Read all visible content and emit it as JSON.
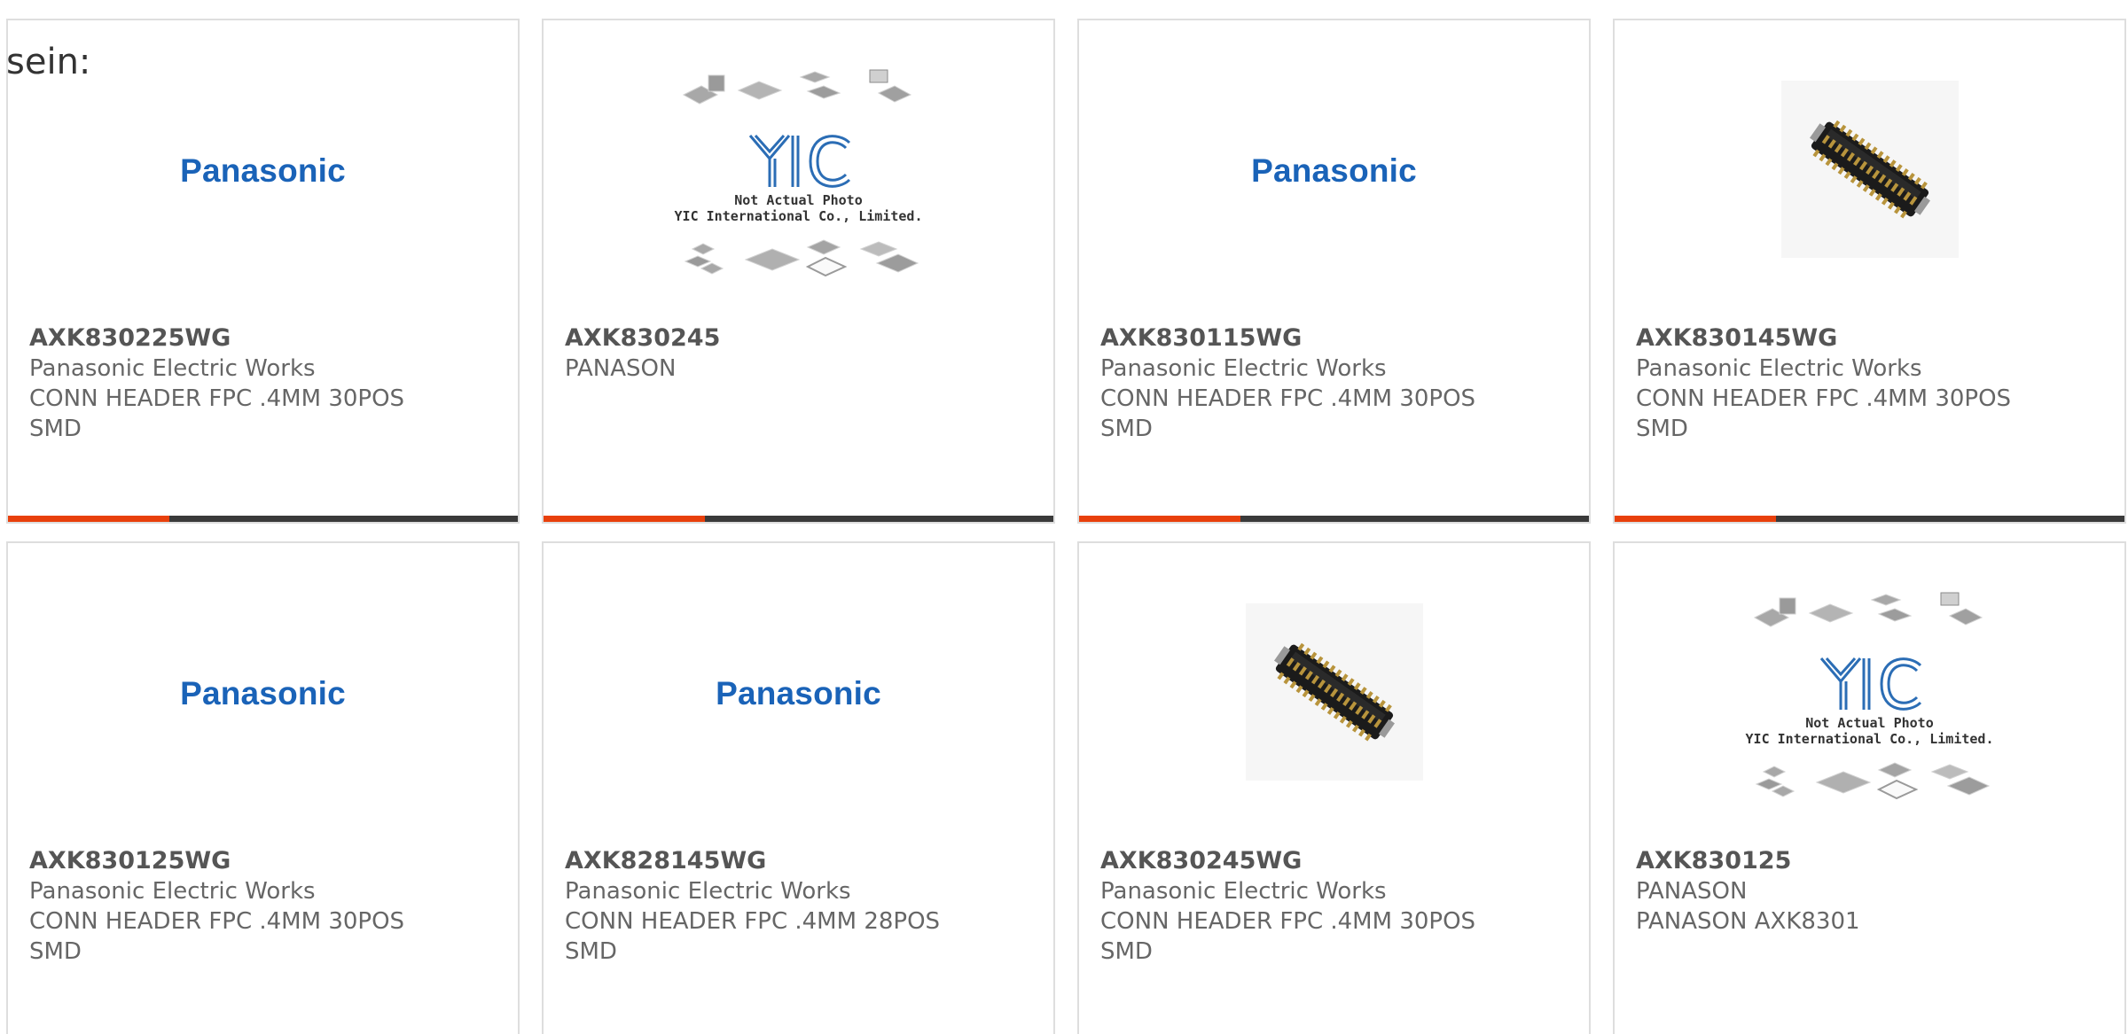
{
  "intro_text": "sein:",
  "cards": [
    {
      "part": "AXK830225WG",
      "maker": "Panasonic Electric Works",
      "desc": "CONN HEADER FPC .4MM 30POS SMD",
      "image": "brand-logo",
      "brand": "Panasonic"
    },
    {
      "part": "AXK830245",
      "maker": "PANASON",
      "desc": "",
      "image": "placeholder-photo",
      "placeholder_line1": "Not Actual Photo",
      "placeholder_line2": "YIC International Co., Limited.",
      "logo_text": "YIC"
    },
    {
      "part": "AXK830115WG",
      "maker": "Panasonic Electric Works",
      "desc": "CONN HEADER FPC .4MM 30POS SMD",
      "image": "brand-logo",
      "brand": "Panasonic"
    },
    {
      "part": "AXK830145WG",
      "maker": "Panasonic Electric Works",
      "desc": "CONN HEADER FPC .4MM 30POS SMD",
      "image": "connector-photo"
    },
    {
      "part": "AXK830125WG",
      "maker": "Panasonic Electric Works",
      "desc": "CONN HEADER FPC .4MM 30POS SMD",
      "image": "brand-logo",
      "brand": "Panasonic"
    },
    {
      "part": "AXK828145WG",
      "maker": "Panasonic Electric Works",
      "desc": "CONN HEADER FPC .4MM 28POS SMD",
      "image": "brand-logo",
      "brand": "Panasonic"
    },
    {
      "part": "AXK830245WG",
      "maker": "Panasonic Electric Works",
      "desc": "CONN HEADER FPC .4MM 30POS SMD",
      "image": "connector-photo"
    },
    {
      "part": "AXK830125",
      "maker": "PANASON",
      "desc": "PANASON AXK8301",
      "image": "placeholder-photo",
      "placeholder_line1": "Not Actual Photo",
      "placeholder_line2": "YIC International Co., Limited.",
      "logo_text": "YIC"
    }
  ],
  "colors": {
    "accent": "#e8400c",
    "bar": "#3a3a3a",
    "brand": "#1a63b8",
    "text": "#666666",
    "border": "#dedede"
  }
}
